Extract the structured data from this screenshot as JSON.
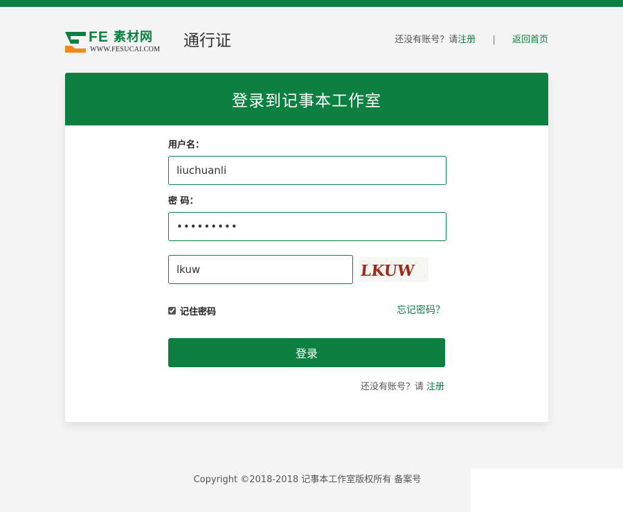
{
  "header": {
    "logo_fe": "FE",
    "logo_cn": "素材网",
    "logo_url": "WWW.FESUCAI.COM",
    "title": "通行证",
    "no_account_text": "还没有账号？请",
    "register_link": "注册",
    "separator": "|",
    "home_link": "返回首页"
  },
  "card": {
    "heading": "登录到记事本工作室"
  },
  "form": {
    "username_label": "用户名：",
    "username_value": "liuchuanli",
    "password_label": "密 码：",
    "password_value": "•••••••••",
    "captcha_value": "lkuw",
    "captcha_text": "LKUW",
    "remember_label": "记住密码",
    "remember_checked": true,
    "forgot_link": "忘记密码？",
    "login_button": "登录",
    "bottom_prompt": "还没有账号？请",
    "bottom_register_link": "注册"
  },
  "footer": {
    "copyright": "Copyright ©2018-2018 记事本工作室版权所有 备案号"
  },
  "colors": {
    "brand_green": "#0c8040",
    "logo_orange": "#f08a1c"
  },
  "icons": [
    "logo-mark-icon",
    "checkbox-icon"
  ]
}
